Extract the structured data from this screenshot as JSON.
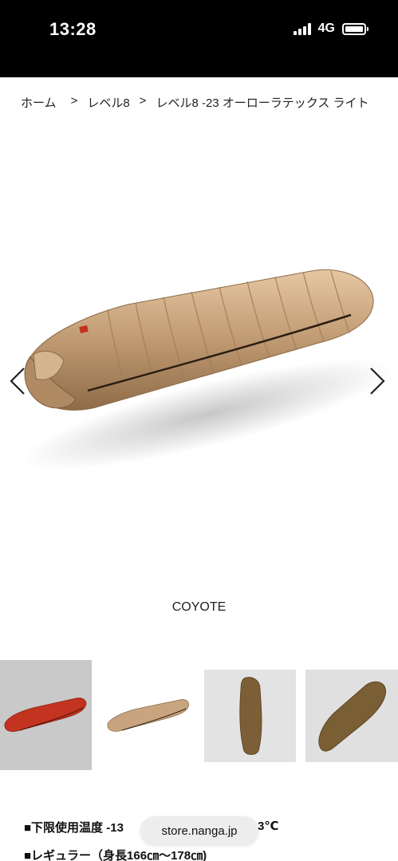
{
  "status_bar": {
    "time": "13:28",
    "network": "4G"
  },
  "breadcrumb": {
    "home": "ホーム",
    "sep": ">",
    "level": "レベル8",
    "current": "レベル8 -23 オーローラテックス ライト"
  },
  "product": {
    "color_name": "COYOTE"
  },
  "thumbnails": [
    {
      "color": "#c0311e"
    },
    {
      "color": "#c9a57f"
    },
    {
      "color": "#7c5f36"
    },
    {
      "color": "#7a5e34"
    }
  ],
  "specs": {
    "line1_prefix": "■下限使用温度 -13",
    "line1_suffix": "3℃",
    "line2": "■レギュラー（身長166㎝〜178㎝)"
  },
  "browser": {
    "url": "store.nanga.jp"
  },
  "colors": {
    "coyote": "#c49e76",
    "coyote_dark": "#8a6a46",
    "red": "#c23420",
    "olive": "#7b5f35"
  }
}
